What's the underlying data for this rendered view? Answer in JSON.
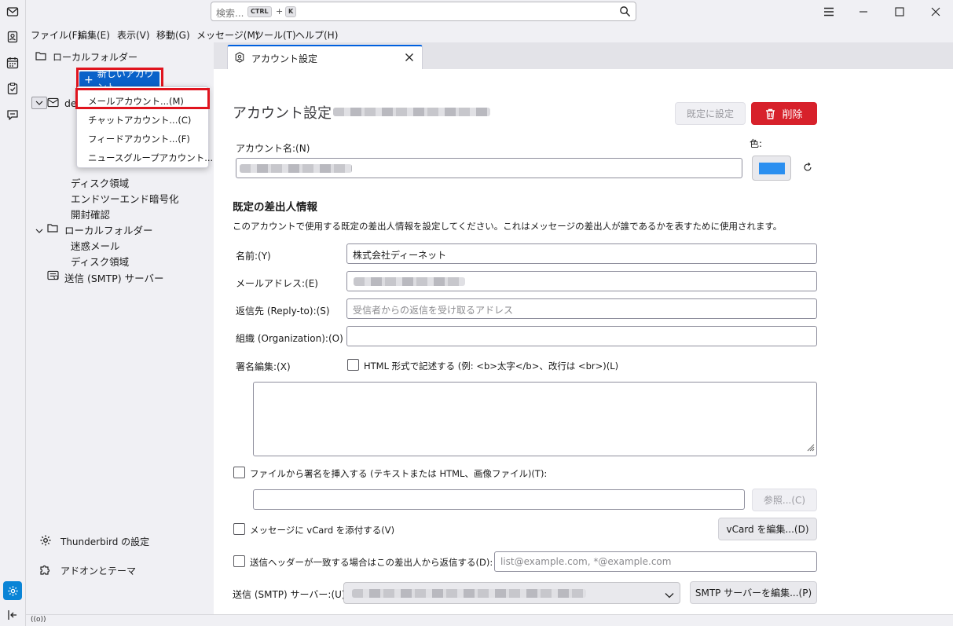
{
  "search": {
    "placeholder": "検索...",
    "key1": "CTRL",
    "plus": "+",
    "key2": "K"
  },
  "menu": [
    "ファイル(F)",
    "編集(E)",
    "表示(V)",
    "移動(G)",
    "メッセージ(M)",
    "ツール(T)",
    "ヘルプ(H)"
  ],
  "folder_pane": {
    "header": "ローカルフォルダー",
    "new_account_label": "新しいアカウント",
    "account_prefix": "de",
    "items": [
      "ディスク領域",
      "エンドツーエンド暗号化",
      "開封確認"
    ],
    "local_folders": "ローカルフォルダー",
    "local_items": [
      "迷惑メール",
      "ディスク領域"
    ],
    "smtp": "送信 (SMTP) サーバー",
    "settings": "Thunderbird の設定",
    "addons": "アドオンとテーマ"
  },
  "popup": {
    "items": [
      "メールアカウント...(M)",
      "チャットアカウント...(C)",
      "フィードアカウント...(F)",
      "ニュースグループアカウント...(N)"
    ]
  },
  "tab": {
    "label": "アカウント設定"
  },
  "content": {
    "title": "アカウント設定 -",
    "default_button": "既定に設定",
    "delete_button": "削除",
    "account_name_label": "アカウント名:(N)",
    "color_label": "色:",
    "account_color": "#2b8ff0",
    "identity_heading": "既定の差出人情報",
    "identity_desc": "このアカウントで使用する既定の差出人情報を設定してください。これはメッセージの差出人が誰であるかを表すために使用されます。",
    "name_label": "名前:(Y)",
    "name_value": "株式会社ディーネット",
    "email_label": "メールアドレス:(E)",
    "replyto_label": "返信先 (Reply-to):(S)",
    "replyto_placeholder": "受信者からの返信を受け取るアドレス",
    "org_label": "組織 (Organization):(O)",
    "signature_label": "署名編集:(X)",
    "html_check_label": "HTML 形式で記述する (例: <b>太字</b>、改行は <br>)(L)",
    "file_sig_label": "ファイルから署名を挿入する (テキストまたは HTML、画像ファイル)(T):",
    "browse_button": "参照...(C)",
    "vcard_label": "メッセージに vCard を添付する(V)",
    "vcard_button": "vCard を編集...(D)",
    "reply_from_label": "送信ヘッダーが一致する場合はこの差出人から返信する(D):",
    "reply_from_placeholder": "list@example.com, *@example.com",
    "smtp_label": "送信 (SMTP) サーバー:(U)",
    "smtp_button": "SMTP サーバーを編集...(P)"
  },
  "status": {
    "icon_text": "((o))"
  }
}
